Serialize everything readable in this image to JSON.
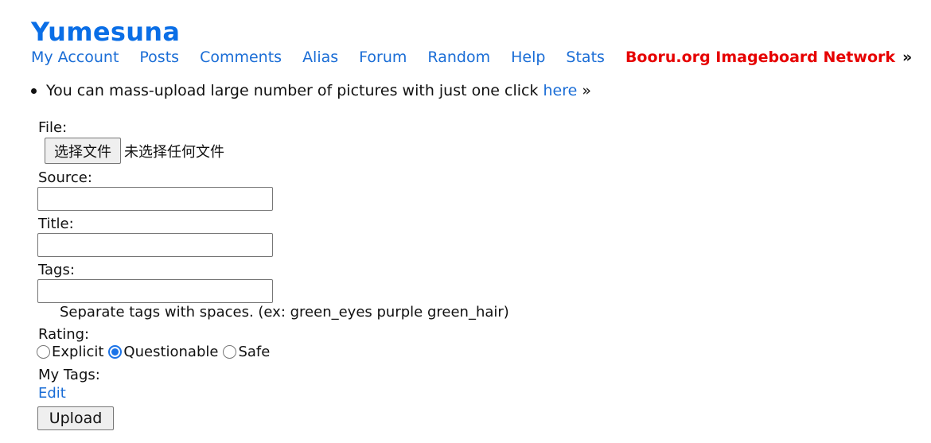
{
  "site": {
    "title": "Yumesuna"
  },
  "nav": {
    "items": [
      {
        "label": "My Account"
      },
      {
        "label": "Posts"
      },
      {
        "label": "Comments"
      },
      {
        "label": "Alias"
      },
      {
        "label": "Forum"
      },
      {
        "label": "Random"
      },
      {
        "label": "Help"
      },
      {
        "label": "Stats"
      }
    ],
    "network_label": "Booru.org Imageboard Network",
    "network_arrow": "»"
  },
  "notice": {
    "text": "You can mass-upload large number of pictures with just one click ",
    "link_label": "here",
    "arrow": " »"
  },
  "form": {
    "file_label": "File:",
    "file_button_label": "选择文件",
    "file_status": "未选择任何文件",
    "source_label": "Source:",
    "source_value": "",
    "title_label": "Title:",
    "title_value": "",
    "tags_label": "Tags:",
    "tags_value": "",
    "tags_hint": "Separate tags with spaces. (ex: green_eyes purple green_hair)",
    "rating_label": "Rating:",
    "rating_options": [
      {
        "label": "Explicit",
        "checked": false
      },
      {
        "label": "Questionable",
        "checked": true
      },
      {
        "label": "Safe",
        "checked": false
      }
    ],
    "my_tags_label": "My Tags:",
    "edit_label": "Edit",
    "upload_label": "Upload"
  },
  "colors": {
    "title": "#0a6ee6",
    "link": "#1a6dd6",
    "network": "#e60000",
    "radio_accent": "#1a73e8"
  }
}
